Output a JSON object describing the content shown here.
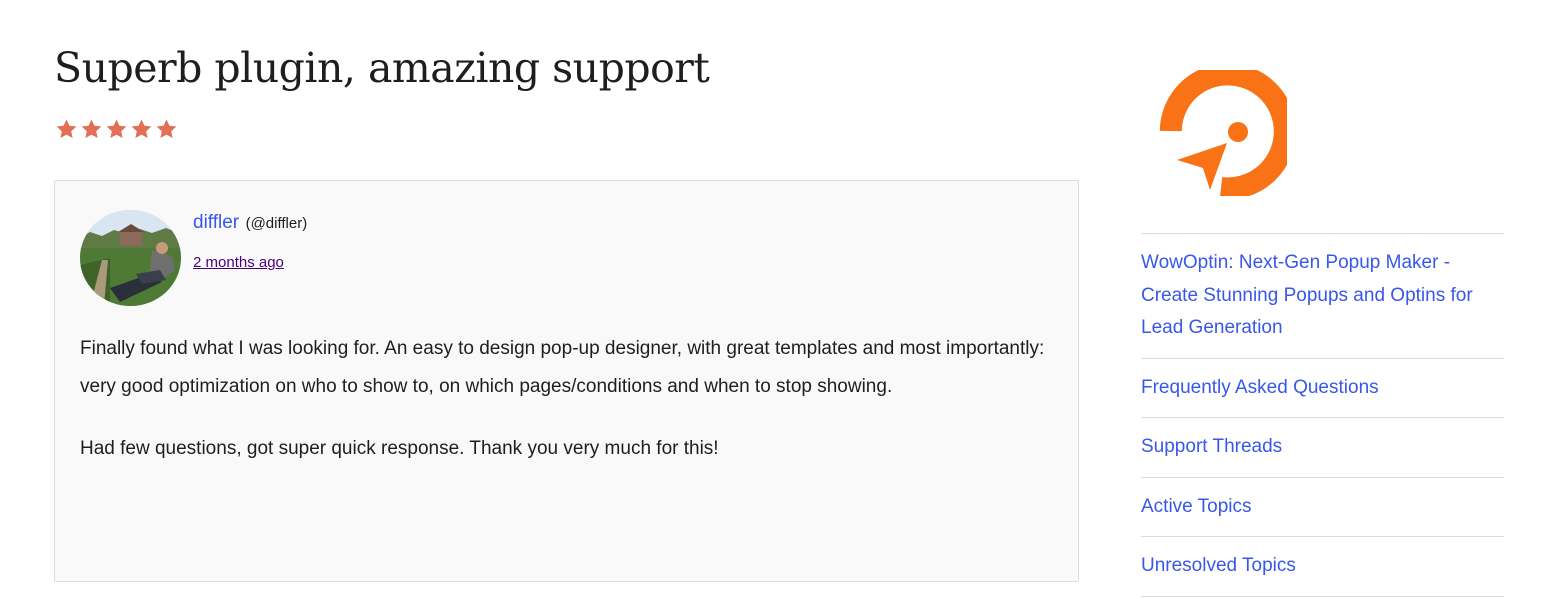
{
  "review": {
    "title": "Superb plugin, amazing support",
    "rating": 5,
    "rating_max": 5,
    "star_color": "#e26f56",
    "author_name": "diffler",
    "author_handle": "(@diffler)",
    "date": "2 months ago",
    "paragraphs": [
      "Finally found what I was looking for. An easy to design pop-up designer, with great templates and most importantly: very good optimization on who to show to, on which pages/conditions and when to stop showing.",
      "Had few questions, got super quick response. Thank you very much for this!"
    ]
  },
  "sidebar": {
    "logo_icon": "wowoptin-logo-icon",
    "logo_color": "#f97316",
    "links": [
      {
        "label": "WowOptin: Next-Gen Popup Maker - Create Stunning Popups and Optins for Lead Generation"
      },
      {
        "label": "Frequently Asked Questions"
      },
      {
        "label": "Support Threads"
      },
      {
        "label": "Active Topics"
      },
      {
        "label": "Unresolved Topics"
      }
    ]
  },
  "colors": {
    "link": "#3858e9",
    "visited_link": "#4b0080",
    "card_bg": "#f9f9f9",
    "border": "#dcdcde"
  }
}
